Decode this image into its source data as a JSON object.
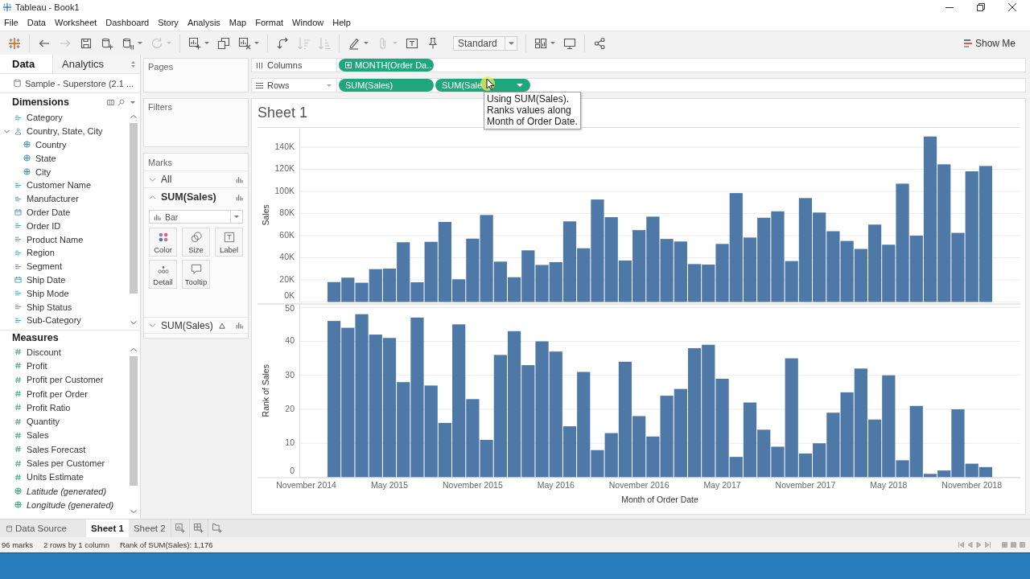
{
  "window": {
    "title": "Tableau - Book1"
  },
  "menu": [
    "File",
    "Data",
    "Worksheet",
    "Dashboard",
    "Story",
    "Analysis",
    "Map",
    "Format",
    "Window",
    "Help"
  ],
  "toolbar": {
    "groups": [
      [
        {
          "kind": "logo",
          "disabled": false,
          "dropdown": false
        }
      ],
      [
        {
          "kind": "back",
          "disabled": false,
          "dropdown": false
        },
        {
          "kind": "forward",
          "disabled": true,
          "dropdown": false
        },
        {
          "kind": "save",
          "disabled": false,
          "dropdown": false
        },
        {
          "kind": "new-data-source",
          "disabled": false,
          "dropdown": false
        },
        {
          "kind": "pause",
          "disabled": false,
          "dropdown": true
        },
        {
          "kind": "refresh",
          "disabled": true,
          "dropdown": true
        }
      ],
      [
        {
          "kind": "new-worksheet",
          "disabled": false,
          "dropdown": true
        },
        {
          "kind": "duplicate",
          "disabled": false,
          "dropdown": false
        },
        {
          "kind": "clear",
          "disabled": false,
          "dropdown": true
        }
      ],
      [
        {
          "kind": "swap",
          "disabled": false,
          "dropdown": false
        },
        {
          "kind": "sort-asc",
          "disabled": true,
          "dropdown": false
        },
        {
          "kind": "sort-desc",
          "disabled": true,
          "dropdown": false
        }
      ],
      [
        {
          "kind": "highlight",
          "disabled": false,
          "dropdown": true
        },
        {
          "kind": "group",
          "disabled": true,
          "dropdown": true
        },
        {
          "kind": "labels",
          "disabled": false,
          "dropdown": false
        },
        {
          "kind": "fix-axes",
          "disabled": false,
          "dropdown": false
        },
        {
          "kind": "fit",
          "value": "Standard"
        }
      ],
      [
        {
          "kind": "cards",
          "disabled": false,
          "dropdown": true
        },
        {
          "kind": "presentation",
          "disabled": false,
          "dropdown": false
        }
      ],
      [
        {
          "kind": "share",
          "disabled": false,
          "dropdown": false
        }
      ]
    ],
    "show_me": "Show Me"
  },
  "data_pane": {
    "tabs": [
      {
        "label": "Data",
        "selected": true
      },
      {
        "label": "Analytics",
        "selected": false
      }
    ],
    "data_source": "Sample - Superstore (2.1 ...",
    "dimensions": {
      "title": "Dimensions",
      "items": [
        {
          "kind": "string",
          "label": "Category"
        },
        {
          "kind": "hierarchy",
          "label": "Country, State, City",
          "expanded": true,
          "children": [
            {
              "kind": "geo",
              "label": "Country"
            },
            {
              "kind": "geo",
              "label": "State"
            },
            {
              "kind": "geo",
              "label": "City"
            }
          ]
        },
        {
          "kind": "string",
          "label": "Customer Name"
        },
        {
          "kind": "string",
          "label": "Manufacturer"
        },
        {
          "kind": "date",
          "label": "Order Date"
        },
        {
          "kind": "string",
          "label": "Order ID"
        },
        {
          "kind": "string",
          "label": "Product Name"
        },
        {
          "kind": "string",
          "label": "Region"
        },
        {
          "kind": "string",
          "label": "Segment"
        },
        {
          "kind": "date",
          "label": "Ship Date"
        },
        {
          "kind": "string",
          "label": "Ship Mode"
        },
        {
          "kind": "string",
          "label": "Ship Status"
        },
        {
          "kind": "string",
          "label": "Sub-Category"
        }
      ]
    },
    "measures": {
      "title": "Measures",
      "items": [
        {
          "kind": "number",
          "label": "Discount",
          "generated": false
        },
        {
          "kind": "number",
          "label": "Profit",
          "generated": false
        },
        {
          "kind": "number",
          "label": "Profit per Customer",
          "generated": false
        },
        {
          "kind": "number",
          "label": "Profit per Order",
          "generated": false
        },
        {
          "kind": "number",
          "label": "Profit Ratio",
          "generated": false
        },
        {
          "kind": "number",
          "label": "Quantity",
          "generated": false
        },
        {
          "kind": "number",
          "label": "Sales",
          "generated": false
        },
        {
          "kind": "number",
          "label": "Sales Forecast",
          "generated": false
        },
        {
          "kind": "number",
          "label": "Sales per Customer",
          "generated": false
        },
        {
          "kind": "number",
          "label": "Units Estimate",
          "generated": false
        },
        {
          "kind": "geo",
          "label": "Latitude (generated)",
          "generated": true
        },
        {
          "kind": "geo",
          "label": "Longitude (generated)",
          "generated": true
        }
      ]
    }
  },
  "cards": {
    "pages": {
      "title": "Pages"
    },
    "filters": {
      "title": "Filters"
    },
    "marks": {
      "title": "Marks",
      "cards": [
        {
          "label": "All",
          "expanded": false,
          "table_calc": false
        },
        {
          "label": "SUM(Sales)",
          "expanded": true,
          "table_calc": false,
          "mark_type": "Bar",
          "properties": [
            {
              "kind": "color",
              "label": "Color"
            },
            {
              "kind": "size",
              "label": "Size"
            },
            {
              "kind": "label",
              "label": "Label"
            },
            {
              "kind": "detail",
              "label": "Detail"
            },
            {
              "kind": "tooltip",
              "label": "Tooltip"
            }
          ]
        },
        {
          "label": "SUM(Sales)",
          "expanded": false,
          "table_calc": true
        }
      ]
    }
  },
  "shelves": [
    {
      "kind": "columns",
      "label": "Columns",
      "pills": [
        {
          "kind": "date",
          "text": "MONTH(Order Da..",
          "hovered": false
        }
      ]
    },
    {
      "kind": "rows",
      "label": "Rows",
      "pills": [
        {
          "kind": "measure",
          "text": "SUM(Sales)",
          "hovered": false
        },
        {
          "kind": "measure",
          "text": "SUM(Sale",
          "hovered": true
        }
      ]
    }
  ],
  "tooltip": {
    "text": "Using SUM(Sales).\nRanks values along\nMonth of Order Date."
  },
  "worksheet": {
    "title": "Sheet 1",
    "panes": [
      {
        "chart_data": {
          "type": "bar",
          "ylabel": "Sales",
          "grid": true,
          "categories": [
            null,
            null,
            null,
            null,
            null,
            null,
            null,
            null,
            null,
            null,
            null,
            null,
            null,
            null,
            null,
            null,
            null,
            null,
            null,
            null,
            null,
            null,
            null,
            null,
            null,
            null,
            null,
            null,
            null,
            null,
            null,
            null,
            null,
            null,
            null,
            null,
            null,
            null,
            null,
            null,
            null,
            null,
            null,
            null,
            null,
            null,
            null,
            null,
            null,
            null,
            null,
            null
          ],
          "values": [
            null,
            null,
            18000,
            22000,
            17400,
            29700,
            30200,
            54000,
            17800,
            54400,
            72400,
            20500,
            57300,
            78700,
            36500,
            22400,
            46700,
            33500,
            36000,
            72900,
            48600,
            92700,
            76700,
            37500,
            65000,
            77200,
            57000,
            54700,
            34300,
            33800,
            52500,
            98500,
            58300,
            76200,
            82000,
            37000,
            94000,
            80900,
            64000,
            55200,
            48000,
            70000,
            51800,
            107000,
            60000,
            149700,
            124500,
            62500,
            118200,
            123000,
            null,
            null
          ],
          "ylim": [
            0,
            157500
          ],
          "yticks": [
            {
              "value": 0,
              "label": "0K"
            },
            {
              "value": 20000,
              "label": "20K"
            },
            {
              "value": 40000,
              "label": "40K"
            },
            {
              "value": 60000,
              "label": "60K"
            },
            {
              "value": 80000,
              "label": "80K"
            },
            {
              "value": 100000,
              "label": "100K"
            },
            {
              "value": 120000,
              "label": "120K"
            },
            {
              "value": 140000,
              "label": "140K"
            }
          ]
        }
      },
      {
        "chart_data": {
          "type": "bar",
          "xlabel": "Month of Order Date",
          "ylabel": "Rank of Sales",
          "grid": true,
          "categories": [
            "November 2014",
            null,
            null,
            null,
            null,
            null,
            "May 2015",
            null,
            null,
            null,
            null,
            null,
            "November 2015",
            null,
            null,
            null,
            null,
            null,
            "May 2016",
            null,
            null,
            null,
            null,
            null,
            "November 2016",
            null,
            null,
            null,
            null,
            null,
            "May 2017",
            null,
            null,
            null,
            null,
            null,
            "November 2017",
            null,
            null,
            null,
            null,
            null,
            "May 2018",
            null,
            null,
            null,
            null,
            null,
            "November 2018",
            null,
            null,
            null
          ],
          "values": [
            null,
            null,
            46,
            44,
            48,
            42,
            41,
            28,
            47,
            27,
            16,
            45,
            23,
            11,
            36,
            43,
            33,
            40,
            37,
            15,
            31,
            8,
            13,
            34,
            18,
            12,
            24,
            26,
            38,
            39,
            29,
            6,
            22,
            14,
            9,
            35,
            7,
            10,
            19,
            25,
            32,
            17,
            30,
            5,
            21,
            1,
            2,
            20,
            4,
            3,
            null,
            null
          ],
          "ylim": [
            0,
            51
          ],
          "yticks": [
            0,
            10,
            20,
            30,
            40,
            50
          ]
        }
      }
    ]
  },
  "sheet_tabs": [
    {
      "kind": "data-source",
      "label": "Data Source",
      "selected": false
    },
    {
      "kind": "sheet",
      "label": "Sheet 1",
      "selected": true
    },
    {
      "kind": "sheet",
      "label": "Sheet 2",
      "selected": false
    }
  ],
  "status_bar": {
    "items": [
      "96 marks",
      "2 rows by 1 column",
      "Rank of SUM(Sales): 1,176"
    ]
  }
}
